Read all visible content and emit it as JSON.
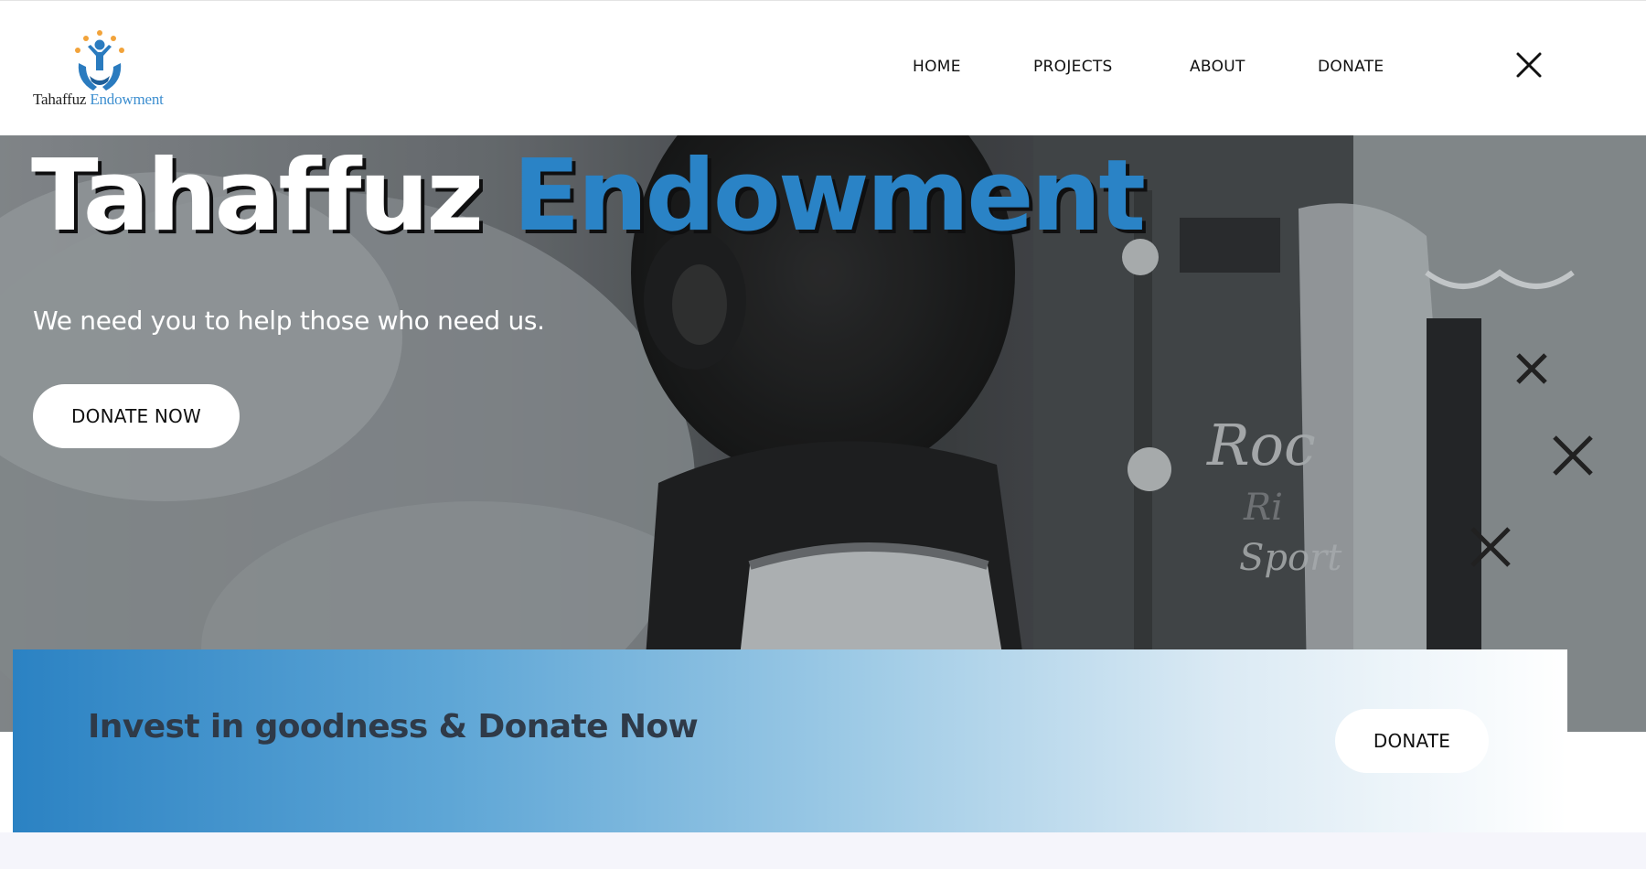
{
  "brand": {
    "logo_icon": "people-in-hands-icon",
    "name_part1": "Tahaffuz",
    "name_part2": "Endowment",
    "colors": {
      "accent_blue": "#2a83c6",
      "logo_orange": "#f2a33a"
    }
  },
  "nav": {
    "items": [
      {
        "label": "HOME"
      },
      {
        "label": "PROJECTS"
      },
      {
        "label": "ABOUT"
      },
      {
        "label": "DONATE"
      }
    ],
    "close_icon": "close-icon"
  },
  "hero": {
    "title_part1": "Tahaffuz",
    "title_part2": "Endowment",
    "subtitle": "We need you to help those who need us.",
    "cta_label": "DONATE NOW",
    "background": "grayscale photo of children"
  },
  "banner": {
    "text": "Invest in goodness & Donate Now",
    "button_label": "DONATE"
  }
}
